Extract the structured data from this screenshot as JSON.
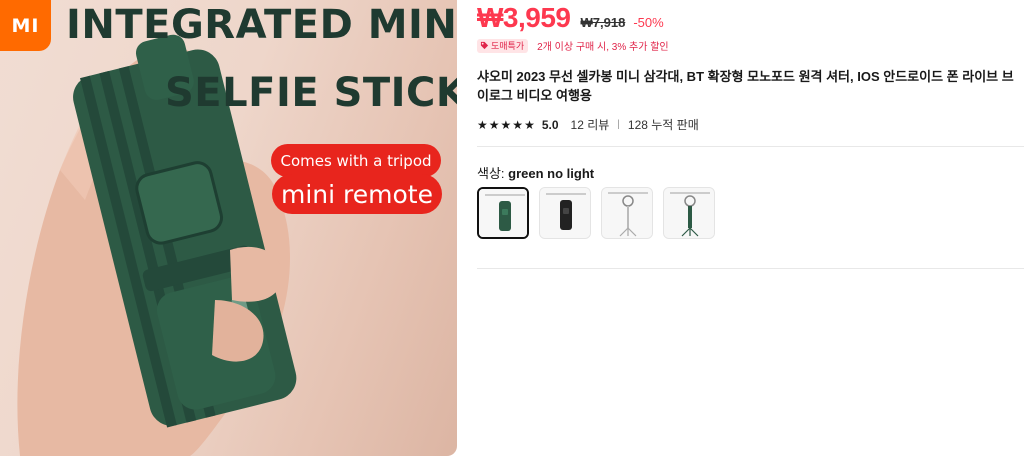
{
  "hero": {
    "logo_text": "MI",
    "title_line1": "INTEGRATED MINI",
    "title_line2": "SELFIE STICK",
    "feature_tripod": "Comes with a tripod",
    "feature_remote": "mini remote"
  },
  "price": {
    "current": "₩3,959",
    "original": "₩7,918",
    "discount": "-50%"
  },
  "promo": {
    "badge": "도매특가",
    "text": "2개 이상 구매 시, 3% 추가 할인"
  },
  "product": {
    "title": "샤오미 2023 무선 셀카봉 미니 삼각대, BT 확장형 모노포드 원격 셔터, IOS 안드로이드 폰 라이브 브이로그 비디오 여행용"
  },
  "rating": {
    "stars": 5,
    "value": "5.0",
    "reviews": "12 리뷰",
    "sold": "128 누적 판매"
  },
  "color": {
    "label": "색상:",
    "selected": "green no light",
    "options": [
      "green no light",
      "black no light",
      "white with light",
      "green with light"
    ]
  },
  "colors": {
    "price_red": "#fd384f",
    "product_green": "#2d5a45",
    "pill_red": "#e8251d",
    "mi_orange": "#ff6a00"
  }
}
